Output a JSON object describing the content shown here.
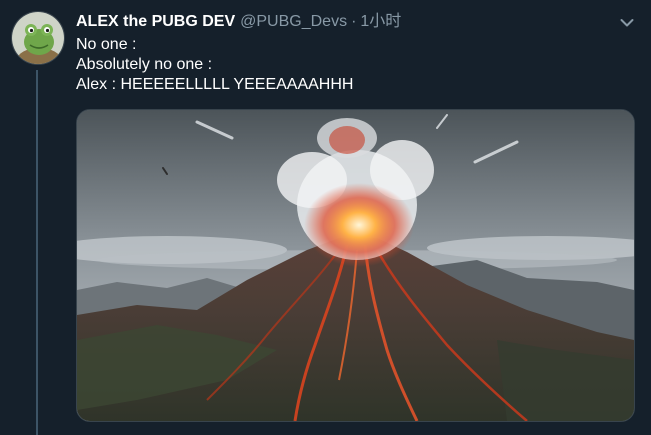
{
  "tweet": {
    "author": {
      "display_name": "ALEX the PUBG DEV",
      "handle": "@PUBG_Devs",
      "avatar_icon": "frog-avatar-icon"
    },
    "separator": "·",
    "time": "1小时",
    "menu_icon": "chevron-down-icon",
    "lines": [
      "No one :",
      "Absolutely no one :",
      "Alex : HEEEEELLLLL YEEEAAAAHHH"
    ],
    "media": {
      "subject": "erupting-volcano-image"
    }
  },
  "colors": {
    "background": "#15202b",
    "text": "#ffffff",
    "secondary_text": "#8899a6",
    "border": "#38444d"
  }
}
